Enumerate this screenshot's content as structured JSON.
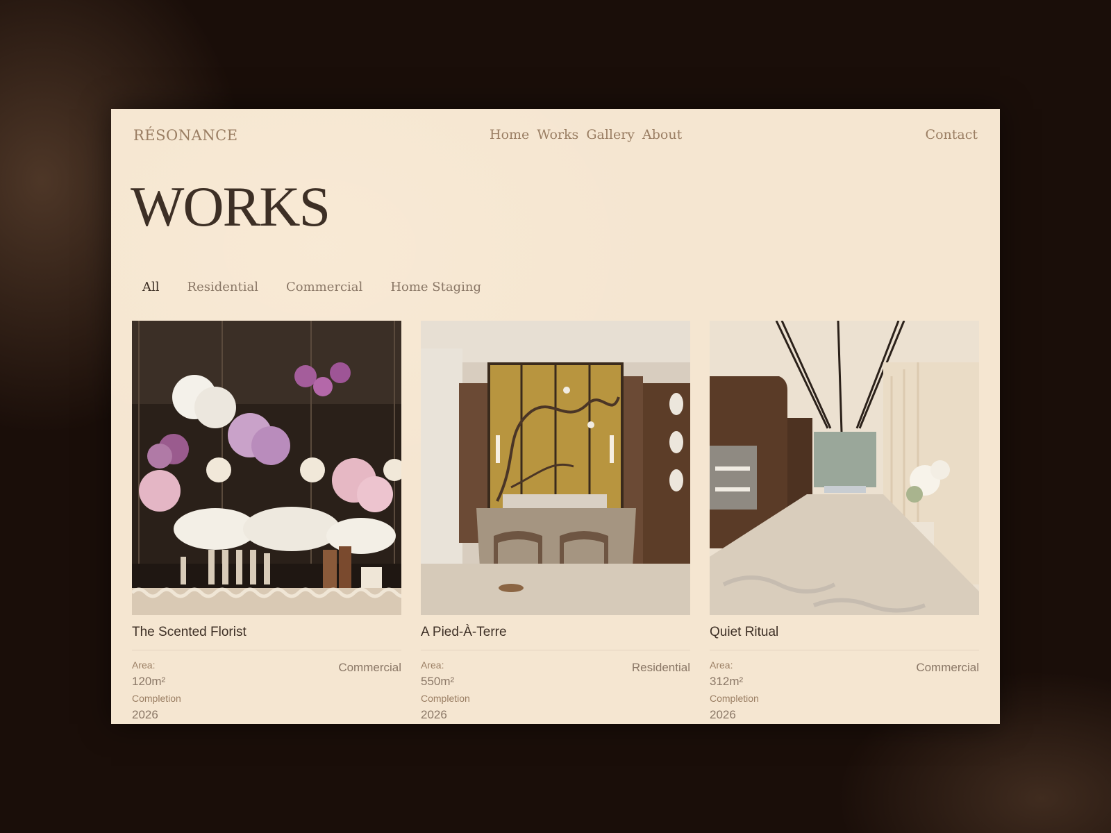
{
  "brand": {
    "logo": "RÉSONANCE"
  },
  "nav": {
    "items": [
      "Home",
      "Works",
      "Gallery",
      "About"
    ],
    "contact": "Contact"
  },
  "page": {
    "title": "WORKS"
  },
  "filters": {
    "tabs": [
      "All",
      "Residential",
      "Commercial",
      "Home Staging"
    ],
    "active": "All"
  },
  "projects": [
    {
      "title": "The Scented Florist",
      "category": "Commercial",
      "area_label": "Area:",
      "area": "120m²",
      "completion_label": "Completion",
      "completion": "2026",
      "image": "florist-interior-photo"
    },
    {
      "title": "A Pied-À-Terre",
      "category": "Residential",
      "area_label": "Area:",
      "area": "550m²",
      "completion_label": "Completion",
      "completion": "2026",
      "image": "bedroom-interior-photo"
    },
    {
      "title": "Quiet Ritual",
      "category": "Commercial",
      "area_label": "Area:",
      "area": "312m²",
      "completion_label": "Completion",
      "completion": "2026",
      "image": "spa-corridor-interior-photo"
    }
  ],
  "colors": {
    "outer_background": "#1a0e09",
    "page_background": "#f5e6d1",
    "heading": "#3d2f25",
    "muted": "#9a7e63"
  }
}
